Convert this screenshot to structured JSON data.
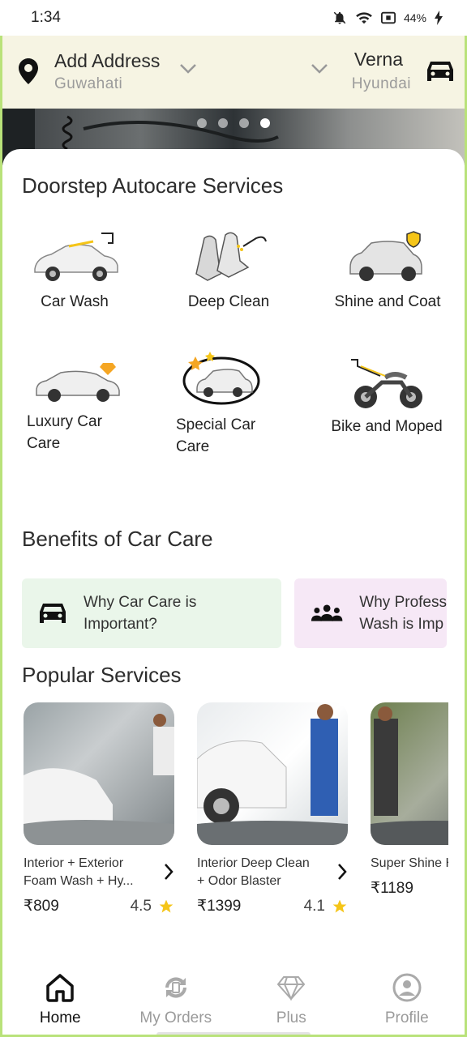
{
  "status": {
    "time": "1:34",
    "battery": "44%"
  },
  "header": {
    "address_title": "Add Address",
    "address_city": "Guwahati",
    "car_model": "Verna",
    "car_brand": "Hyundai"
  },
  "banner": {
    "slides": 4,
    "active_index": 3
  },
  "services_section": {
    "title": "Doorstep Autocare Services",
    "items": [
      {
        "label": "Car Wash",
        "icon": "car-wash-icon"
      },
      {
        "label": "Deep Clean",
        "icon": "seat-clean-icon"
      },
      {
        "label": "Shine and Coat",
        "icon": "suv-shield-icon"
      },
      {
        "label": "Luxury Car\nCare",
        "icon": "luxury-car-icon"
      },
      {
        "label": "Special Car\nCare",
        "icon": "special-car-icon"
      },
      {
        "label": "Bike and Moped",
        "icon": "motorbike-icon"
      }
    ]
  },
  "benefits_section": {
    "title": "Benefits of Car Care",
    "cards": [
      {
        "text": "Why Car Care is\nImportant?",
        "icon": "car-icon",
        "color": "#eaf6ea"
      },
      {
        "text": "Why Profess\nWash is Imp",
        "icon": "group-icon",
        "color": "#f6e8f6"
      }
    ]
  },
  "popular_section": {
    "title": "Popular Services",
    "cards": [
      {
        "name": "Interior + Exterior Foam Wash + Hy...",
        "price": "₹809",
        "rating": "4.5"
      },
      {
        "name": "Interior Deep Clean + Odor Blaster",
        "price": "₹1399",
        "rating": "4.1"
      },
      {
        "name": "Super Shine Hydrophobic",
        "price": "₹1189",
        "rating": ""
      }
    ]
  },
  "nav": {
    "items": [
      {
        "label": "Home",
        "icon": "home-icon",
        "active": true
      },
      {
        "label": "My Orders",
        "icon": "orders-icon",
        "active": false
      },
      {
        "label": "Plus",
        "icon": "diamond-icon",
        "active": false
      },
      {
        "label": "Profile",
        "icon": "profile-icon",
        "active": false
      }
    ]
  },
  "colors": {
    "accent_border": "#b9e27a",
    "header_bg": "#f6f4e3",
    "star": "#f5c518"
  }
}
